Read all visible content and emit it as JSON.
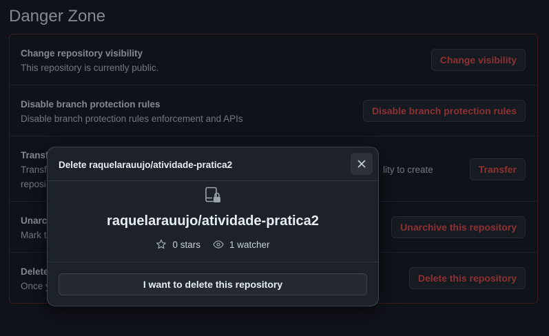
{
  "page": {
    "heading": "Danger Zone"
  },
  "danger_zone": {
    "rows": [
      {
        "title": "Change repository visibility",
        "description": "This repository is currently public.",
        "button": "Change visibility"
      },
      {
        "title": "Disable branch protection rules",
        "description": "Disable branch protection rules enforcement and APIs",
        "button": "Disable branch protection rules"
      },
      {
        "title": "Transf",
        "description": "Transf",
        "description_line2": "reposi",
        "description_tail": "lity to create",
        "button": "Transfer"
      },
      {
        "title": "Unarch",
        "description": "Mark t",
        "button": "Unarchive this repository"
      },
      {
        "title": "Delete",
        "description": "Once y",
        "button": "Delete this repository"
      }
    ]
  },
  "modal": {
    "title": "Delete raquelarauujo/atividade-pratica2",
    "repo_name": "raquelarauujo/atividade-pratica2",
    "stars": "0 stars",
    "watchers": "1 watcher",
    "confirm_button": "I want to delete this repository"
  },
  "colors": {
    "danger": "#d94a4a",
    "background": "#171b22",
    "modal_background": "#1d2128"
  },
  "icons": {
    "close": "x-icon",
    "repo": "repo-locked-icon",
    "star": "star-icon",
    "watch": "eye-icon"
  }
}
